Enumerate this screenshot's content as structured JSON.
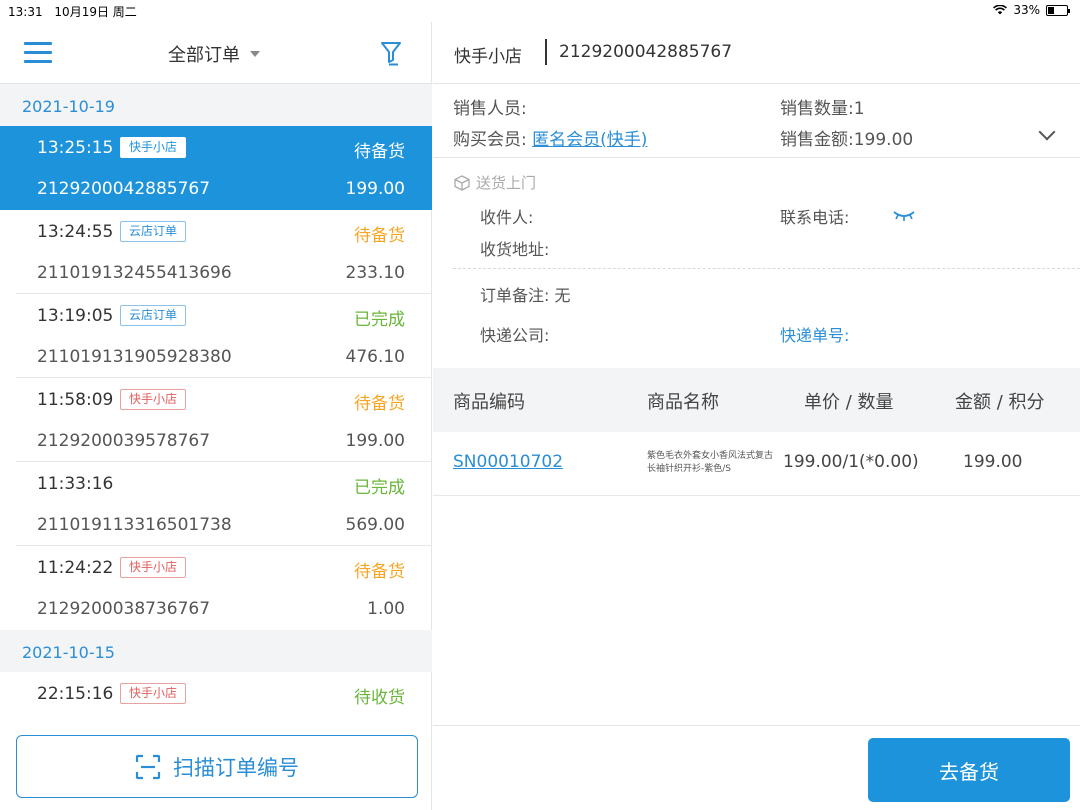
{
  "status_bar": {
    "time": "13:31",
    "date": "10月19日 周二",
    "battery": "33%"
  },
  "left_header": {
    "title": "全部订单"
  },
  "groups": [
    {
      "date": "2021-10-19",
      "orders": [
        {
          "time": "13:25:15",
          "tag": "快手小店",
          "tag_type": "kuaishou",
          "status": "待备货",
          "status_type": "pending",
          "order_no": "2129200042885767",
          "amount": "199.00",
          "selected": true
        },
        {
          "time": "13:24:55",
          "tag": "云店订单",
          "tag_type": "cloud",
          "status": "待备货",
          "status_type": "pending",
          "order_no": "211019132455413696",
          "amount": "233.10"
        },
        {
          "time": "13:19:05",
          "tag": "云店订单",
          "tag_type": "cloud",
          "status": "已完成",
          "status_type": "done",
          "order_no": "211019131905928380",
          "amount": "476.10"
        },
        {
          "time": "11:58:09",
          "tag": "快手小店",
          "tag_type": "kuaishou",
          "status": "待备货",
          "status_type": "pending",
          "order_no": "2129200039578767",
          "amount": "199.00"
        },
        {
          "time": "11:33:16",
          "tag": "",
          "tag_type": "",
          "status": "已完成",
          "status_type": "done",
          "order_no": "211019113316501738",
          "amount": "569.00"
        },
        {
          "time": "11:24:22",
          "tag": "快手小店",
          "tag_type": "kuaishou",
          "status": "待备货",
          "status_type": "pending",
          "order_no": "2129200038736767",
          "amount": "1.00"
        }
      ]
    },
    {
      "date": "2021-10-15",
      "orders": [
        {
          "time": "22:15:16",
          "tag": "快手小店",
          "tag_type": "kuaishou",
          "status": "待收货",
          "status_type": "receive",
          "order_no": "",
          "amount": ""
        }
      ]
    }
  ],
  "scan_button": {
    "label": "扫描订单编号"
  },
  "detail": {
    "shop": "快手小店",
    "order_no": "2129200042885767",
    "sales_person_label": "销售人员:",
    "member_label": "购买会员:",
    "member_value": "匿名会员(快手)",
    "quantity_label": "销售数量:1",
    "amount_label": "销售金额:199.00",
    "delivery_type": "送货上门",
    "receiver_label": "收件人:",
    "phone_label": "联系电话:",
    "address_label": "收货地址:",
    "note_label": "订单备注: 无",
    "express_label": "快递公司:",
    "tracking_label": "快递单号:"
  },
  "table": {
    "headers": {
      "code": "商品编码",
      "name": "商品名称",
      "price": "单价 / 数量",
      "amount": "金额 / 积分"
    },
    "rows": [
      {
        "code": "SN00010702",
        "name": "紫色毛衣外套女小香风法式复古长袖针织开衫-紫色/S",
        "price_qty": "199.00/1(*0.00)",
        "amount": "199.00"
      }
    ]
  },
  "prepare_button": {
    "label": "去备货"
  }
}
